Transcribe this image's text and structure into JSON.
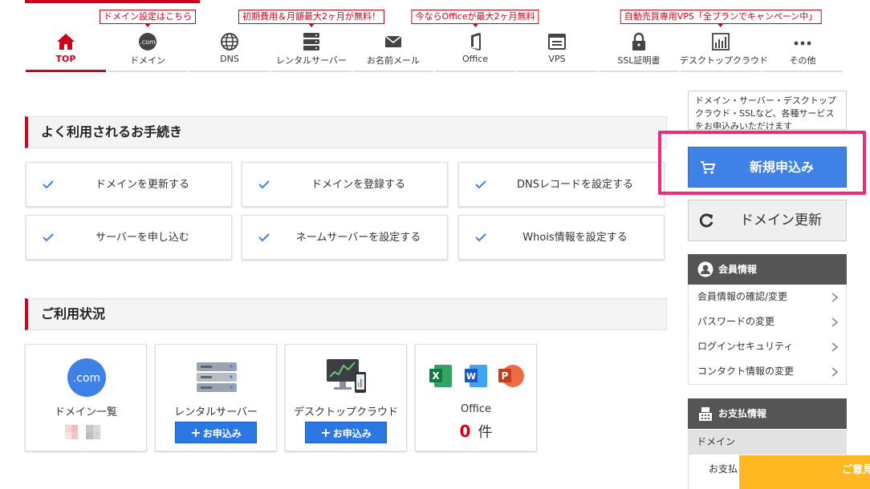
{
  "nav": {
    "items": [
      {
        "label": "TOP",
        "icon": "home-icon",
        "promo": ""
      },
      {
        "label": "ドメイン",
        "icon": "dotcom-icon",
        "promo": "ドメイン設定はこちら"
      },
      {
        "label": "DNS",
        "icon": "globe-icon",
        "promo": ""
      },
      {
        "label": "レンタルサーバー",
        "icon": "server-icon",
        "promo": "初期費用＆月額最大2ヶ月が無料！"
      },
      {
        "label": "お名前メール",
        "icon": "mail-icon",
        "promo": ""
      },
      {
        "label": "Office",
        "icon": "office-icon",
        "promo": "今ならOfficeが最大2ヶ月無料"
      },
      {
        "label": "VPS",
        "icon": "vps-icon",
        "promo": ""
      },
      {
        "label": "SSL証明書",
        "icon": "lock-icon",
        "promo": ""
      },
      {
        "label": "デスクトップクラウド",
        "icon": "desktop-cloud-icon",
        "promo": "自動売買専用VPS「全プランでキャンペーン中」"
      },
      {
        "label": "その他",
        "icon": "more-icon",
        "promo": ""
      }
    ],
    "active_color": "#d0021b"
  },
  "procedures": {
    "title": "よく利用されるお手続き",
    "items": [
      {
        "label": "ドメインを更新する"
      },
      {
        "label": "ドメインを登録する"
      },
      {
        "label": "DNSレコードを設定する"
      },
      {
        "label": "サーバーを申し込む"
      },
      {
        "label": "ネームサーバーを設定する"
      },
      {
        "label": "Whois情報を設定する"
      }
    ]
  },
  "usage": {
    "title": "ご利用状況",
    "cards": [
      {
        "title": "ドメイン一覧",
        "icon": "dotcom-icon",
        "button": "",
        "count": ""
      },
      {
        "title": "レンタルサーバー",
        "icon": "server-rack-icon",
        "button": "お申込み",
        "count": ""
      },
      {
        "title": "デスクトップクラウド",
        "icon": "desktop-chart-icon",
        "button": "お申込み",
        "count": ""
      },
      {
        "title": "Office",
        "icon": "office-apps-icon",
        "button": "",
        "count": "0",
        "count_unit": "件"
      }
    ]
  },
  "sidebar": {
    "info_text": "ドメイン・サーバー・デスクトップクラウド・SSLなど、各種サービスをお申込みいただけます",
    "new_apply_label": "新規申込み",
    "renew_label": "ドメイン更新",
    "member": {
      "title": "会員情報",
      "items": [
        {
          "label": "会員情報の確認/変更"
        },
        {
          "label": "パスワードの変更"
        },
        {
          "label": "ログインセキュリティ"
        },
        {
          "label": "コンタクト情報の変更"
        }
      ]
    },
    "payment": {
      "title": "お支払情報",
      "sub_label": "ドメイン",
      "sub_item": "お支払"
    },
    "notice_tab": "ご意見"
  },
  "colors": {
    "brand_red": "#d0021b",
    "primary_blue": "#3e82e8",
    "highlight_pink": "#ee2a7b",
    "notice_orange": "#ffb822"
  }
}
